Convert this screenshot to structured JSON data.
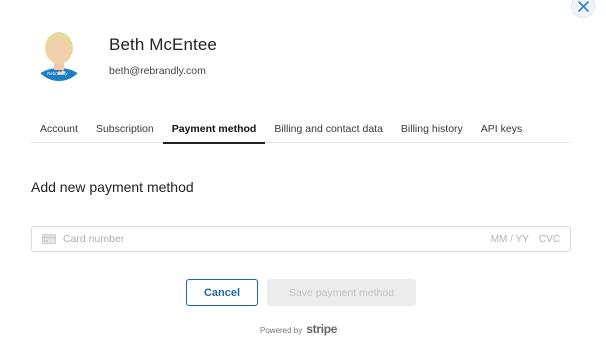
{
  "icons": {
    "close": "close-icon",
    "card": "credit-card-icon"
  },
  "profile": {
    "name": "Beth McEntee",
    "email": "beth@rebrandly.com",
    "avatar_shirt_text": "Rebrandly"
  },
  "tabs": [
    {
      "label": "Account",
      "active": false
    },
    {
      "label": "Subscription",
      "active": false
    },
    {
      "label": "Payment method",
      "active": true
    },
    {
      "label": "Billing and contact data",
      "active": false
    },
    {
      "label": "Billing history",
      "active": false
    },
    {
      "label": "API keys",
      "active": false
    }
  ],
  "payment": {
    "section_title": "Add new payment method",
    "card_placeholder": "Card number",
    "expiry_placeholder": "MM / YY",
    "cvc_placeholder": "CVC"
  },
  "actions": {
    "cancel_label": "Cancel",
    "save_label": "Save payment method"
  },
  "footer": {
    "powered_by": "Powered by",
    "brand": "stripe"
  },
  "colors": {
    "accent": "#1c6b9c",
    "disabled_bg": "#ececec",
    "avatar_shirt": "#1a7fc4"
  }
}
